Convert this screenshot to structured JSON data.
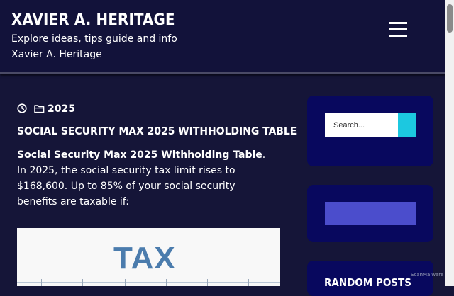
{
  "header": {
    "site_title": "XAVIER A. HERITAGE",
    "tagline": "Explore ideas, tips guide and info Xavier A. Heritage",
    "menu_icon": "hamburger-menu-icon"
  },
  "post": {
    "meta": {
      "date_icon": "clock-icon",
      "category_icon": "folder-icon",
      "category": "2025"
    },
    "title": "SOCIAL SECURITY MAX 2025 WITHHOLDING TABLE",
    "excerpt_bold": "Social Security Max 2025 Withholding Table",
    "excerpt_rest": ". In 2025, the social security tax limit rises to $168,600. Up to 85% of your social security benefits are taxable if:",
    "image_text": "TAX"
  },
  "sidebar": {
    "search": {
      "placeholder": "Search...",
      "button_icon": "search-icon"
    },
    "random_posts_heading": "RANDOM POSTS"
  },
  "watermark": "ScanMalware",
  "colors": {
    "page_bg": "#151538",
    "header_bg": "#12123a",
    "widget_bg": "#08085e",
    "accent_cyan": "#1cc8e0",
    "accent_purple": "#4b4dcc",
    "tax_blue": "#4b7cad"
  }
}
